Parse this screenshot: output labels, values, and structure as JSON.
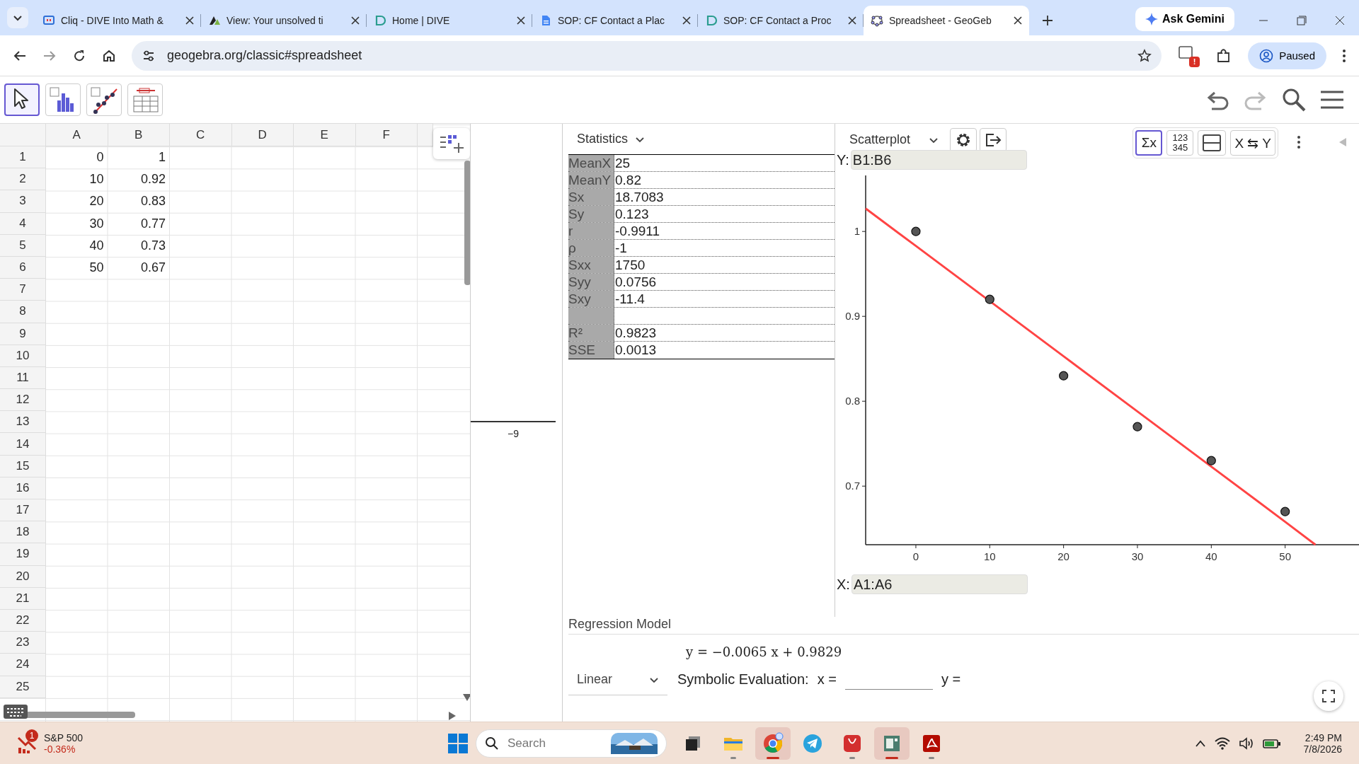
{
  "browser": {
    "tabs": [
      {
        "title": "Cliq - DIVE Into Math &",
        "selected": false
      },
      {
        "title": "View: Your unsolved ti",
        "selected": false
      },
      {
        "title": "Home | DIVE",
        "selected": false
      },
      {
        "title": "SOP: CF Contact a Plac",
        "selected": false
      },
      {
        "title": "SOP: CF Contact a Proc",
        "selected": false
      },
      {
        "title": "Spreadsheet - GeoGeb",
        "selected": true
      }
    ],
    "gemini": "Ask Gemini",
    "address": "geogebra.org/classic#spreadsheet",
    "extension_badge": "!",
    "profile": "Paused"
  },
  "toolbar": {
    "tools": [
      {
        "selected": true
      },
      {
        "selected": false
      },
      {
        "selected": false
      },
      {
        "selected": false
      }
    ]
  },
  "spreadsheet": {
    "columns": [
      "A",
      "B",
      "C",
      "D",
      "E",
      "F"
    ],
    "rows": [
      {
        "number": "1",
        "cells": [
          "0",
          "1"
        ]
      },
      {
        "number": "2",
        "cells": [
          "10",
          "0.92"
        ]
      },
      {
        "number": "3",
        "cells": [
          "20",
          "0.83"
        ]
      },
      {
        "number": "4",
        "cells": [
          "30",
          "0.77"
        ]
      },
      {
        "number": "5",
        "cells": [
          "40",
          "0.73"
        ]
      },
      {
        "number": "6",
        "cells": [
          "50",
          "0.67"
        ]
      },
      {
        "number": "7"
      },
      {
        "number": "8"
      },
      {
        "number": "9"
      },
      {
        "number": "10"
      },
      {
        "number": "11"
      },
      {
        "number": "12"
      },
      {
        "number": "13"
      },
      {
        "number": "14"
      },
      {
        "number": "15"
      },
      {
        "number": "16"
      },
      {
        "number": "17"
      },
      {
        "number": "18"
      },
      {
        "number": "19"
      },
      {
        "number": "20"
      },
      {
        "number": "21"
      },
      {
        "number": "22"
      },
      {
        "number": "23"
      },
      {
        "number": "24"
      },
      {
        "number": "25"
      }
    ]
  },
  "graphics": {
    "tick": "−9"
  },
  "statistics": {
    "menu": "Statistics",
    "rows": [
      {
        "kind": "stat",
        "label": "MeanX",
        "value": "25"
      },
      {
        "kind": "stat",
        "label": "MeanY",
        "value": "0.82"
      },
      {
        "kind": "stat",
        "label": "Sx",
        "value": "18.7083"
      },
      {
        "kind": "stat",
        "label": "Sy",
        "value": "0.123"
      },
      {
        "kind": "stat",
        "label": "r",
        "value": "-0.9911"
      },
      {
        "kind": "stat",
        "label": "ρ",
        "value": "-1"
      },
      {
        "kind": "stat",
        "label": "Sxx",
        "value": "1750"
      },
      {
        "kind": "stat",
        "label": "Syy",
        "value": "0.0756"
      },
      {
        "kind": "stat",
        "label": "Sxy",
        "value": "-11.4"
      },
      {
        "kind": "blank"
      },
      {
        "kind": "stat",
        "label": "R²",
        "value": "0.9823"
      },
      {
        "kind": "stat",
        "label": "SSE",
        "value": "0.0013"
      }
    ]
  },
  "plot": {
    "menu": "Scatterplot",
    "tools": [
      {
        "kind": "text",
        "label": "Σx",
        "selected": true
      },
      {
        "kind": "stack",
        "lines": [
          "123",
          "345"
        ],
        "selected": false
      },
      {
        "kind": "icon",
        "selected": false
      },
      {
        "kind": "text",
        "label": "X ⇆ Y",
        "selected": false
      }
    ],
    "y_field": {
      "label": "Y:",
      "value": "B1:B6"
    },
    "x_field": {
      "label": "X:",
      "value": "A1:A6"
    },
    "chart_data": {
      "type": "scatter",
      "x": [
        -6.8,
        0,
        10,
        20,
        30,
        40,
        50,
        54.1
      ],
      "series": [
        {
          "color": "#555555",
          "values": [
            null,
            1,
            0.92,
            0.83,
            0.77,
            0.73,
            0.67,
            null
          ]
        },
        {
          "type": "line",
          "color": "#ff4444",
          "values": [
            1.027,
            0.983,
            0.918,
            0.853,
            0.788,
            0.723,
            0.658,
            0.631
          ]
        }
      ],
      "xlim": [
        -6.8,
        60
      ],
      "ylim": [
        0.631,
        1.066
      ],
      "xticks": [
        0,
        10,
        20,
        30,
        40,
        50
      ],
      "yticks": [
        0.7,
        0.8,
        0.9,
        1
      ]
    }
  },
  "regression": {
    "title": "Regression Model",
    "model": "Linear",
    "equation": "y = −0.0065 x + 0.9829",
    "evaluation_label": "Symbolic Evaluation:",
    "x_label": "x =",
    "y_label": "y ="
  },
  "taskbar": {
    "widget": {
      "name": "S&P 500",
      "change": "-0.36%",
      "badge": "1"
    },
    "search_placeholder": "Search",
    "apps": [
      {
        "kind": "task-view",
        "selected": false,
        "running": false
      },
      {
        "kind": "folder",
        "selected": false,
        "running": true
      },
      {
        "kind": "chrome",
        "selected": true,
        "running": true
      },
      {
        "kind": "telegram",
        "selected": false,
        "running": false
      },
      {
        "kind": "red-app",
        "selected": false,
        "running": true
      },
      {
        "kind": "green-app",
        "selected": true,
        "running": true
      },
      {
        "kind": "pdf",
        "selected": false,
        "running": true
      }
    ],
    "time": "2:49 PM",
    "date": "7/8/2026"
  }
}
